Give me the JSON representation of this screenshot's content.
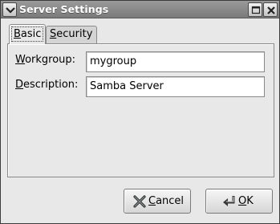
{
  "window": {
    "title": "Server Settings"
  },
  "tabs": [
    {
      "label": "Basic",
      "mnemonic": "B",
      "rest": "asic",
      "selected": true
    },
    {
      "label": "Security",
      "mnemonic": "S",
      "rest": "ecurity",
      "selected": false
    }
  ],
  "form": {
    "workgroup": {
      "label": "Workgroup:",
      "mnemonic": "W",
      "rest": "orkgroup:",
      "value": "mygroup"
    },
    "description": {
      "label": "Description:",
      "mnemonic": "D",
      "rest": "escription:",
      "value": "Samba Server"
    }
  },
  "buttons": {
    "cancel": {
      "label": "Cancel",
      "mnemonic": "C",
      "rest": "ancel",
      "icon": "cancel-x-icon"
    },
    "ok": {
      "label": "OK",
      "mnemonic": "O",
      "rest": "K",
      "icon": "ok-arrow-icon"
    }
  },
  "colors": {
    "titlebar": "#8a8a8a",
    "window_bg": "#e8e8e8",
    "cancel_icon": "#2e3436"
  }
}
